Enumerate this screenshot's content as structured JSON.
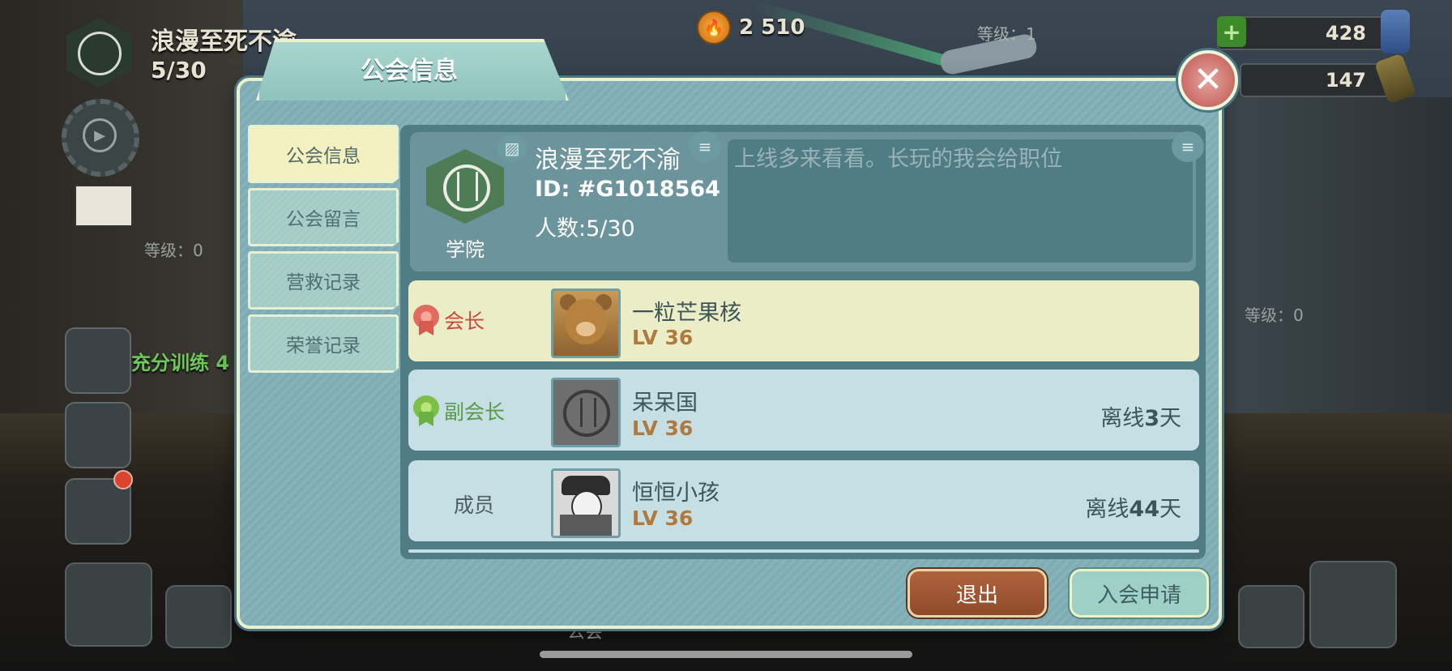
{
  "hud": {
    "guild_name": "浪漫至死不渝",
    "guild_count": "5/30",
    "caps": "2 510",
    "level_top": "等级：1",
    "level_left": "等级：0",
    "level_right": "等级：0",
    "training_text": "充分训练 4",
    "res_one": "428",
    "res_two": "147",
    "bottom_label": "公会"
  },
  "dialog": {
    "title": "公会信息",
    "close_glyph": "✕",
    "tabs": [
      {
        "label": "公会信息",
        "active": true
      },
      {
        "label": "公会留言",
        "active": false
      },
      {
        "label": "营救记录",
        "active": false
      },
      {
        "label": "荣誉记录",
        "active": false
      }
    ],
    "info": {
      "class_label": "学院",
      "name": "浪漫至死不渝",
      "id": "ID: #G1018564",
      "members": "人数:5/30",
      "description": "上线多来看看。长玩的我会给职位"
    },
    "members": [
      {
        "role": "会长",
        "name": "一粒芒果核",
        "level": "LV 36",
        "offline_prefix": "",
        "offline_num": "",
        "offline_suffix": ""
      },
      {
        "role": "副会长",
        "name": "呆呆国",
        "level": "LV 36",
        "offline_prefix": "离线",
        "offline_num": "3",
        "offline_suffix": "天"
      },
      {
        "role": "成员",
        "name": "恒恒小孩",
        "level": "LV 36",
        "offline_prefix": "离线",
        "offline_num": "44",
        "offline_suffix": "天"
      }
    ],
    "buttons": {
      "quit": "退出",
      "apply": "入会申请"
    }
  },
  "colors": {
    "dialog_bg": "#7fabb5",
    "active_tab": "#f3f1c0",
    "leader_row": "#ebedc7",
    "member_row": "#c5dfe4",
    "leader_role": "#c94a3a",
    "vice_role": "#5b9a48",
    "quit_button": "#a0563a",
    "apply_button": "#9fd0c8"
  },
  "icons": [
    "vault-boy-emblem-icon",
    "bottle-cap-icon",
    "close-icon",
    "image-icon",
    "notes-icon",
    "rosette-icon",
    "teddy-bear-avatar",
    "vault-boy-avatar",
    "detective-avatar"
  ]
}
